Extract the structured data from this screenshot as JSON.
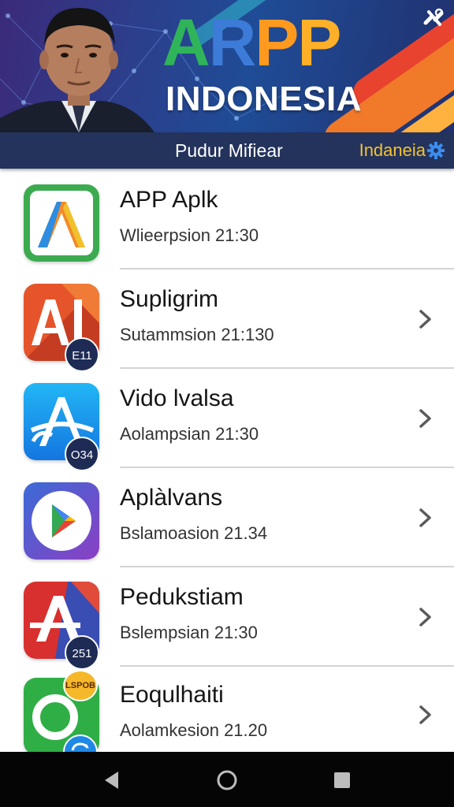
{
  "banner": {
    "title_letters": [
      "A",
      "R",
      "P",
      "P"
    ],
    "subtitle": "INDONESIA",
    "corner_icon": "tools-icon"
  },
  "subheader": {
    "title": "Pudur Mifiear",
    "right_label": "Indaneia",
    "right_icon": "gear-icon"
  },
  "apps": [
    {
      "name": "APP Aplk",
      "subtitle": "Wlieerpsion 21:30",
      "badge": "",
      "icon": "app-a-icon"
    },
    {
      "name": "Supligrim",
      "subtitle": "Sutammsion 21:130",
      "badge": "E11",
      "icon": "app-ai-icon"
    },
    {
      "name": "Vido lvalsa",
      "subtitle": "Aolampsian 21:30",
      "badge": "O34",
      "icon": "app-store-icon"
    },
    {
      "name": "Aplàlvans",
      "subtitle": "Bslamoasion 21.34",
      "badge": "",
      "icon": "play-icon"
    },
    {
      "name": "Pedukstiam",
      "subtitle": "Bslempsian 21:30",
      "badge": "251",
      "icon": "app-a-red-icon"
    },
    {
      "name": "Eoqulhaiti",
      "subtitle": "Aolamkesion 21.20",
      "badge": "LSPOB",
      "icon": "app-o-icon"
    }
  ],
  "navbar": {
    "back_icon": "back-icon",
    "home_icon": "home-icon",
    "recents_icon": "recents-icon"
  }
}
